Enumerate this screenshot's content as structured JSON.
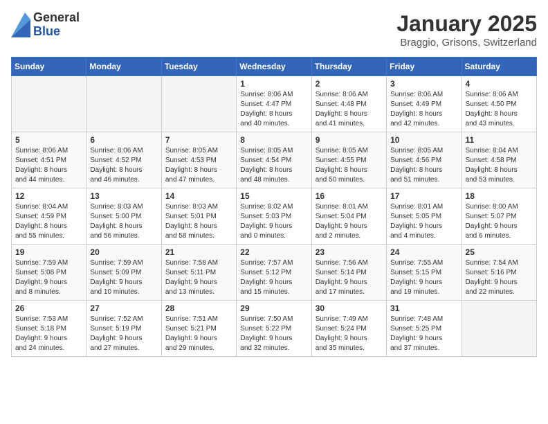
{
  "logo": {
    "general": "General",
    "blue": "Blue"
  },
  "title": "January 2025",
  "location": "Braggio, Grisons, Switzerland",
  "days_header": [
    "Sunday",
    "Monday",
    "Tuesday",
    "Wednesday",
    "Thursday",
    "Friday",
    "Saturday"
  ],
  "weeks": [
    [
      {
        "day": "",
        "detail": ""
      },
      {
        "day": "",
        "detail": ""
      },
      {
        "day": "",
        "detail": ""
      },
      {
        "day": "1",
        "detail": "Sunrise: 8:06 AM\nSunset: 4:47 PM\nDaylight: 8 hours\nand 40 minutes."
      },
      {
        "day": "2",
        "detail": "Sunrise: 8:06 AM\nSunset: 4:48 PM\nDaylight: 8 hours\nand 41 minutes."
      },
      {
        "day": "3",
        "detail": "Sunrise: 8:06 AM\nSunset: 4:49 PM\nDaylight: 8 hours\nand 42 minutes."
      },
      {
        "day": "4",
        "detail": "Sunrise: 8:06 AM\nSunset: 4:50 PM\nDaylight: 8 hours\nand 43 minutes."
      }
    ],
    [
      {
        "day": "5",
        "detail": "Sunrise: 8:06 AM\nSunset: 4:51 PM\nDaylight: 8 hours\nand 44 minutes."
      },
      {
        "day": "6",
        "detail": "Sunrise: 8:06 AM\nSunset: 4:52 PM\nDaylight: 8 hours\nand 46 minutes."
      },
      {
        "day": "7",
        "detail": "Sunrise: 8:05 AM\nSunset: 4:53 PM\nDaylight: 8 hours\nand 47 minutes."
      },
      {
        "day": "8",
        "detail": "Sunrise: 8:05 AM\nSunset: 4:54 PM\nDaylight: 8 hours\nand 48 minutes."
      },
      {
        "day": "9",
        "detail": "Sunrise: 8:05 AM\nSunset: 4:55 PM\nDaylight: 8 hours\nand 50 minutes."
      },
      {
        "day": "10",
        "detail": "Sunrise: 8:05 AM\nSunset: 4:56 PM\nDaylight: 8 hours\nand 51 minutes."
      },
      {
        "day": "11",
        "detail": "Sunrise: 8:04 AM\nSunset: 4:58 PM\nDaylight: 8 hours\nand 53 minutes."
      }
    ],
    [
      {
        "day": "12",
        "detail": "Sunrise: 8:04 AM\nSunset: 4:59 PM\nDaylight: 8 hours\nand 55 minutes."
      },
      {
        "day": "13",
        "detail": "Sunrise: 8:03 AM\nSunset: 5:00 PM\nDaylight: 8 hours\nand 56 minutes."
      },
      {
        "day": "14",
        "detail": "Sunrise: 8:03 AM\nSunset: 5:01 PM\nDaylight: 8 hours\nand 58 minutes."
      },
      {
        "day": "15",
        "detail": "Sunrise: 8:02 AM\nSunset: 5:03 PM\nDaylight: 9 hours\nand 0 minutes."
      },
      {
        "day": "16",
        "detail": "Sunrise: 8:01 AM\nSunset: 5:04 PM\nDaylight: 9 hours\nand 2 minutes."
      },
      {
        "day": "17",
        "detail": "Sunrise: 8:01 AM\nSunset: 5:05 PM\nDaylight: 9 hours\nand 4 minutes."
      },
      {
        "day": "18",
        "detail": "Sunrise: 8:00 AM\nSunset: 5:07 PM\nDaylight: 9 hours\nand 6 minutes."
      }
    ],
    [
      {
        "day": "19",
        "detail": "Sunrise: 7:59 AM\nSunset: 5:08 PM\nDaylight: 9 hours\nand 8 minutes."
      },
      {
        "day": "20",
        "detail": "Sunrise: 7:59 AM\nSunset: 5:09 PM\nDaylight: 9 hours\nand 10 minutes."
      },
      {
        "day": "21",
        "detail": "Sunrise: 7:58 AM\nSunset: 5:11 PM\nDaylight: 9 hours\nand 13 minutes."
      },
      {
        "day": "22",
        "detail": "Sunrise: 7:57 AM\nSunset: 5:12 PM\nDaylight: 9 hours\nand 15 minutes."
      },
      {
        "day": "23",
        "detail": "Sunrise: 7:56 AM\nSunset: 5:14 PM\nDaylight: 9 hours\nand 17 minutes."
      },
      {
        "day": "24",
        "detail": "Sunrise: 7:55 AM\nSunset: 5:15 PM\nDaylight: 9 hours\nand 19 minutes."
      },
      {
        "day": "25",
        "detail": "Sunrise: 7:54 AM\nSunset: 5:16 PM\nDaylight: 9 hours\nand 22 minutes."
      }
    ],
    [
      {
        "day": "26",
        "detail": "Sunrise: 7:53 AM\nSunset: 5:18 PM\nDaylight: 9 hours\nand 24 minutes."
      },
      {
        "day": "27",
        "detail": "Sunrise: 7:52 AM\nSunset: 5:19 PM\nDaylight: 9 hours\nand 27 minutes."
      },
      {
        "day": "28",
        "detail": "Sunrise: 7:51 AM\nSunset: 5:21 PM\nDaylight: 9 hours\nand 29 minutes."
      },
      {
        "day": "29",
        "detail": "Sunrise: 7:50 AM\nSunset: 5:22 PM\nDaylight: 9 hours\nand 32 minutes."
      },
      {
        "day": "30",
        "detail": "Sunrise: 7:49 AM\nSunset: 5:24 PM\nDaylight: 9 hours\nand 35 minutes."
      },
      {
        "day": "31",
        "detail": "Sunrise: 7:48 AM\nSunset: 5:25 PM\nDaylight: 9 hours\nand 37 minutes."
      },
      {
        "day": "",
        "detail": ""
      }
    ]
  ]
}
